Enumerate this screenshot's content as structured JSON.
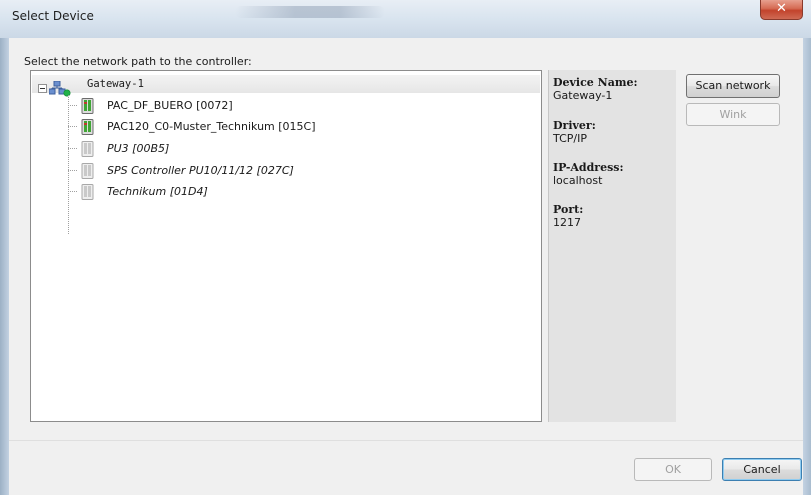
{
  "window": {
    "title": "Select Device"
  },
  "prompt": "Select the network path to the controller:",
  "tree": {
    "root": {
      "label": "Gateway-1",
      "expanded": true
    },
    "devices": [
      {
        "label": "PAC_DF_BUERO [0072]",
        "online": true
      },
      {
        "label": "PAC120_C0-Muster_Technikum [015C]",
        "online": true
      },
      {
        "label": "PU3 [00B5]",
        "online": false
      },
      {
        "label": "SPS Controller PU10/11/12 [027C]",
        "online": false
      },
      {
        "label": "Technikum [01D4]",
        "online": false
      }
    ]
  },
  "info": {
    "device_name_title": "Device Name:",
    "device_name_value": "Gateway-1",
    "driver_title": "Driver:",
    "driver_value": "TCP/IP",
    "ip_title": "IP-Address:",
    "ip_value": "localhost",
    "port_title": "Port:",
    "port_value": "1217"
  },
  "buttons": {
    "scan_network": "Scan network",
    "wink": "Wink",
    "ok": "OK",
    "cancel": "Cancel"
  },
  "colors": {
    "close_button": "#c9452f",
    "online_icon": "#3fa535",
    "offline_icon": "#b9b9b9",
    "gateway_status": "#21b14a"
  }
}
